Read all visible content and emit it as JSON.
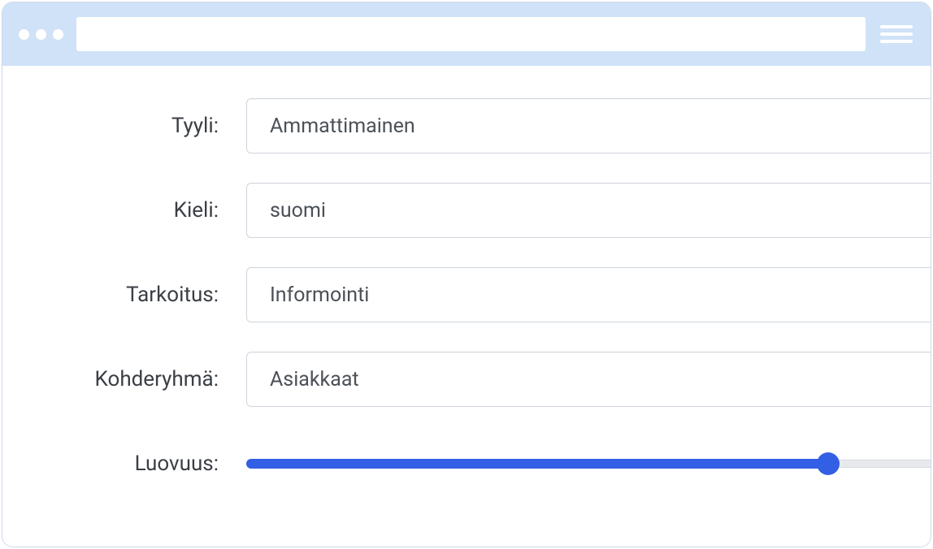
{
  "fields": {
    "style": {
      "label": "Tyyli:",
      "value": "Ammattimainen"
    },
    "language": {
      "label": "Kieli:",
      "value": "suomi"
    },
    "purpose": {
      "label": "Tarkoitus:",
      "value": "Informointi"
    },
    "audience": {
      "label": "Kohderyhmä:",
      "value": "Asiakkaat"
    },
    "creativity": {
      "label": "Luovuus:",
      "percent": 85
    }
  },
  "colors": {
    "accent": "#335fe4",
    "titlebar": "#cfe2f7",
    "border": "#cfd6dd"
  }
}
